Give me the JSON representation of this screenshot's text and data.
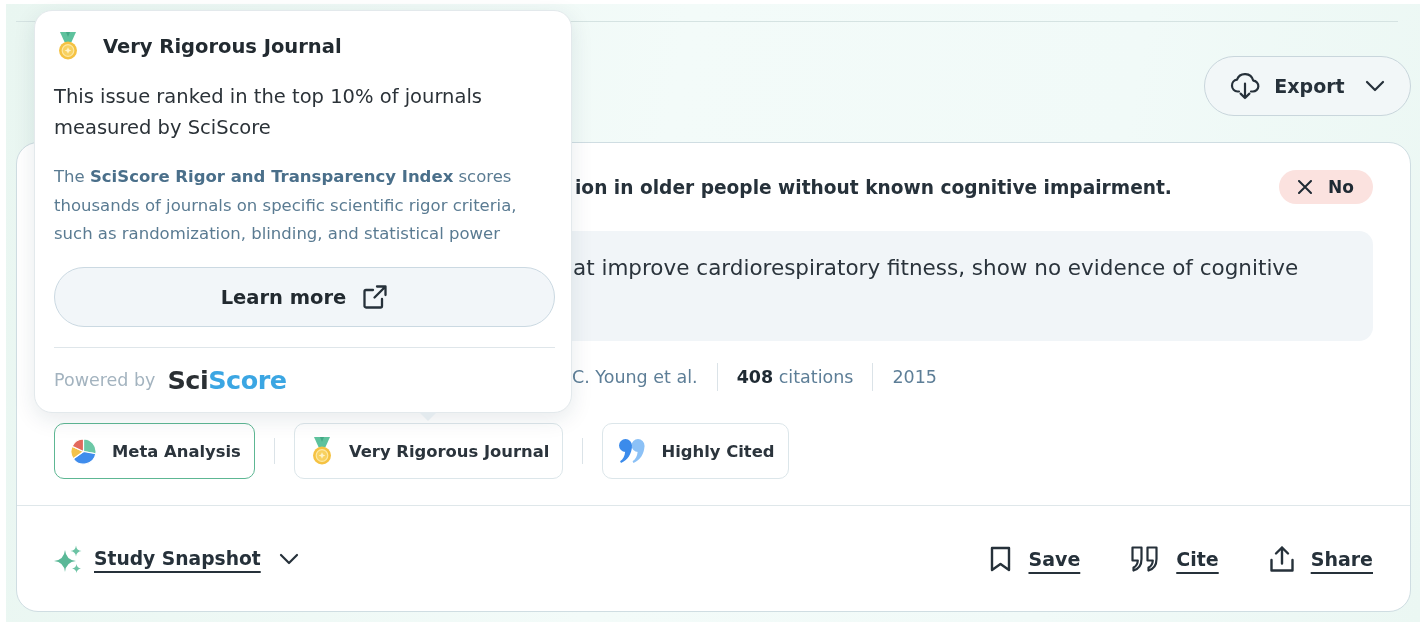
{
  "toolbar": {
    "export_button": {
      "label": "Export"
    }
  },
  "result_card": {
    "claim": {
      "text": "ion in older people without known cognitive impairment.",
      "answer": {
        "label": "No",
        "kind": "no"
      }
    },
    "excerpt": "at improve cardiorespiratory fitness, show no evidence of cognitive",
    "meta": {
      "authors": "C. Young et al.",
      "citations": "**408** citations",
      "year": "2015"
    },
    "badges": [
      {
        "kind": "meta_analysis",
        "label": "Meta Analysis",
        "highlighted": true
      },
      {
        "kind": "rigorous_journal",
        "label": "Very Rigorous Journal",
        "highlighted": false
      },
      {
        "kind": "highly_cited",
        "label": "Highly Cited",
        "highlighted": false
      }
    ],
    "footer": {
      "snapshot": {
        "label": "Study Snapshot",
        "expanded": false
      },
      "actions": [
        {
          "kind": "save",
          "label": "Save"
        },
        {
          "kind": "cite",
          "label": "Cite"
        },
        {
          "kind": "share",
          "label": "Share"
        }
      ]
    }
  },
  "tooltip": {
    "title": "Very Rigorous Journal",
    "summary": "This issue ranked in the top 10% of journals measured by SciScore",
    "description": "The **SciScore Rigor and Transparency Index** scores thousands of journals on specific scientific rigor criteria, such as randomization, blinding, and statistical power",
    "button": {
      "label": "Learn more"
    },
    "powered_by": "Powered by",
    "logo": {
      "dark": "Sci",
      "accent": "Score"
    }
  }
}
